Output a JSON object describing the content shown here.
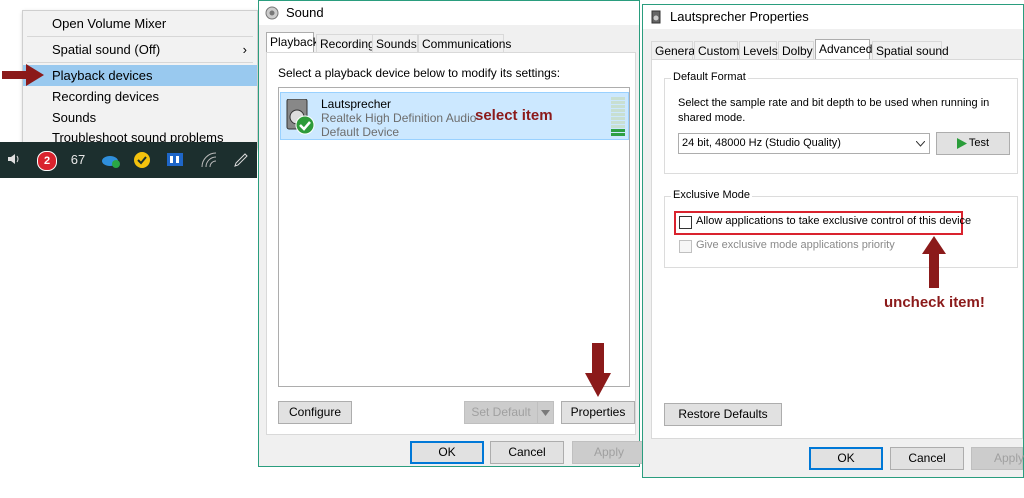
{
  "context_menu": {
    "items": [
      {
        "label": "Open Volume Mixer"
      },
      {
        "label": "Spatial sound (Off)",
        "chevron": "›"
      },
      {
        "label": "Playback devices"
      },
      {
        "label": "Recording devices"
      },
      {
        "label": "Sounds"
      },
      {
        "label": "Troubleshoot sound problems"
      }
    ]
  },
  "taskbar": {
    "badge_count": "2",
    "temperature": "67"
  },
  "sound_dialog": {
    "title": "Sound",
    "tabs": [
      "Playback",
      "Recording",
      "Sounds",
      "Communications"
    ],
    "instruction": "Select a playback device below to modify its settings:",
    "device": {
      "name": "Lautsprecher",
      "driver": "Realtek High Definition Audio",
      "status": "Default Device",
      "level_fraction": 0.15
    },
    "annotation_select": "select item",
    "configure_label": "Configure",
    "set_default_label": "Set Default",
    "properties_label": "Properties",
    "ok_label": "OK",
    "cancel_label": "Cancel",
    "apply_label": "Apply"
  },
  "props_dialog": {
    "title": "Lautsprecher Properties",
    "tabs": [
      "General",
      "Custom",
      "Levels",
      "Dolby",
      "Advanced",
      "Spatial sound"
    ],
    "default_format": {
      "legend": "Default Format",
      "description": "Select the sample rate and bit depth to be used when running in shared mode.",
      "selected": "24 bit, 48000 Hz (Studio Quality)",
      "test_label": "Test"
    },
    "exclusive_mode": {
      "legend": "Exclusive Mode",
      "allow_label": "Allow applications to take exclusive control of this device",
      "allow_checked": false,
      "priority_label": "Give exclusive mode applications priority",
      "priority_checked": false
    },
    "annotation_uncheck": "uncheck item!",
    "restore_label": "Restore Defaults",
    "ok_label": "OK",
    "cancel_label": "Cancel",
    "apply_label": "Apply"
  },
  "colors": {
    "annotation": "#8b1a1a",
    "highlight": "#99c9ef",
    "accent": "#0078d7",
    "red_box": "#d9232e"
  }
}
